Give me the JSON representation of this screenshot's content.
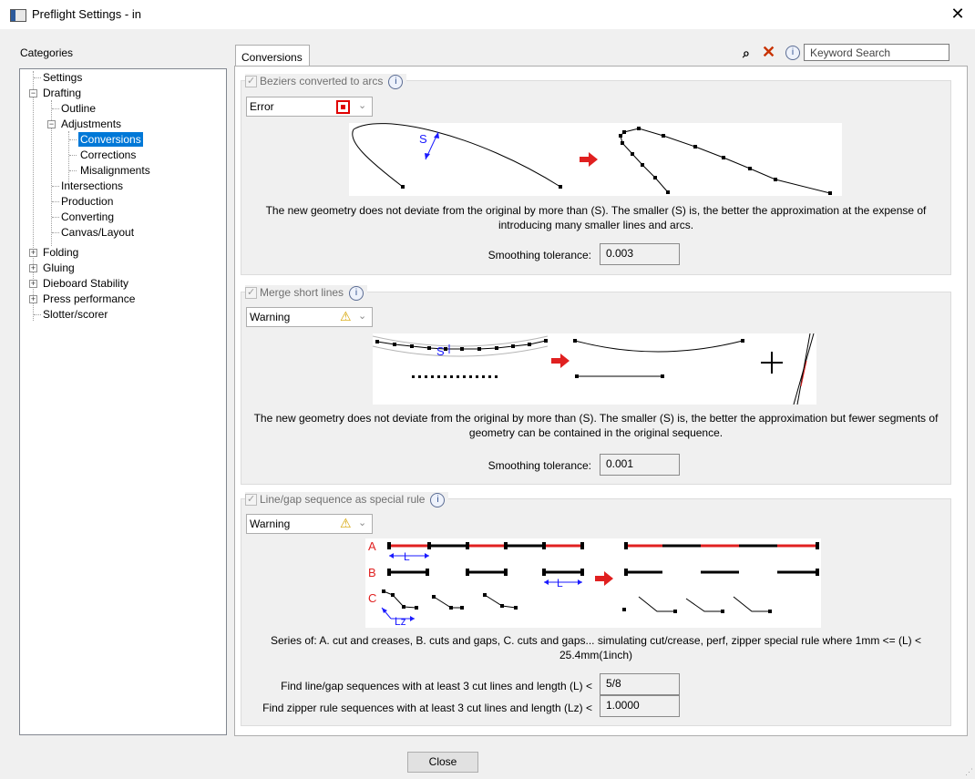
{
  "window": {
    "title": "Preflight Settings - in",
    "close_glyph": "✕"
  },
  "categories": {
    "label": "Categories",
    "items": [
      {
        "label": "Settings",
        "expander": ""
      },
      {
        "label": "Drafting",
        "expander": "−"
      },
      {
        "label": "Outline",
        "expander": ""
      },
      {
        "label": "Adjustments",
        "expander": "−"
      },
      {
        "label": "Conversions",
        "expander": "",
        "selected": true
      },
      {
        "label": "Corrections",
        "expander": ""
      },
      {
        "label": "Misalignments",
        "expander": ""
      },
      {
        "label": "Intersections",
        "expander": ""
      },
      {
        "label": "Production",
        "expander": ""
      },
      {
        "label": "Converting",
        "expander": ""
      },
      {
        "label": "Canvas/Layout",
        "expander": ""
      },
      {
        "label": "Folding",
        "expander": "+"
      },
      {
        "label": "Gluing",
        "expander": "+"
      },
      {
        "label": "Dieboard Stability",
        "expander": "+"
      },
      {
        "label": "Press performance",
        "expander": "+"
      },
      {
        "label": "Slotter/scorer",
        "expander": ""
      }
    ]
  },
  "tab": {
    "label": "Conversions"
  },
  "search": {
    "placeholder": "Keyword Search",
    "find_icon": "search-icon",
    "clear_icon": "clear-icon",
    "info_icon": "info-icon"
  },
  "sections": {
    "beziers": {
      "title": "Beziers converted to arcs",
      "checked": true,
      "severity": "Error",
      "illustration_label": "S",
      "description": "The new geometry does not deviate from the original by more than (S).  The smaller (S) is, the better the approximation at the expense of introducing many smaller lines and arcs.",
      "field_label": "Smoothing tolerance:",
      "field_value": "0.003"
    },
    "merge": {
      "title": "Merge short lines",
      "checked": true,
      "severity": "Warning",
      "illustration_label": "S",
      "description": "The new geometry does not deviate from the original by more than (S).  The smaller (S) is, the better the approximation but fewer segments of geometry can be contained in the original sequence.",
      "field_label": "Smoothing tolerance:",
      "field_value": "0.001"
    },
    "linegap": {
      "title": "Line/gap sequence as special rule",
      "checked": true,
      "severity": "Warning",
      "illustration_labels": {
        "a": "A",
        "b": "B",
        "c": "C",
        "l": "L",
        "lz": "Lz"
      },
      "description": "Series of: A. cut and creases, B. cuts and gaps, C. cuts and gaps... simulating cut/crease, perf, zipper special rule where 1mm <= (L) < 25.4mm(1inch)",
      "field1_label": "Find line/gap sequences with at least 3 cut lines and length (L) <",
      "field1_value": "5/8",
      "field2_label": "Find zipper rule sequences with at least 3 cut lines and length (Lz) <",
      "field2_value": "1.0000"
    }
  },
  "footer": {
    "close_label": "Close"
  },
  "colors": {
    "selection": "#0078d7",
    "error": "#e00000",
    "arrow": "#e02020",
    "label_blue": "#1a1aff",
    "label_red": "#e02020"
  }
}
